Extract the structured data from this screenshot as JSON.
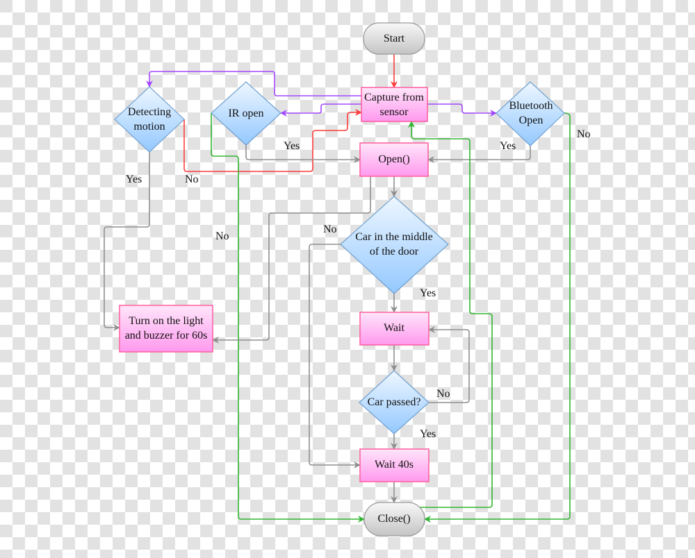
{
  "colors": {
    "process_fill": "#ff9cf0",
    "process_border": "#ff5c9d",
    "decision_fill": "#a8d2ff",
    "decision_border": "#6f9fd0",
    "terminal_fill": "#cfcfcf",
    "edge_gray": "#8f8f8f",
    "edge_red": "#ff3b3b",
    "edge_purple": "#a347ff",
    "edge_green": "#2fb52f"
  },
  "nodes": {
    "start": [
      "Start"
    ],
    "capture": [
      "Capture from",
      "sensor"
    ],
    "detecting": [
      "Detecting",
      "motion"
    ],
    "ir": [
      "IR open"
    ],
    "bluetooth": [
      "Bluetooth",
      "Open"
    ],
    "open": [
      "Open()"
    ],
    "car_middle": [
      "Car in the middle",
      "of the door"
    ],
    "turn_on": [
      "Turn on the light",
      "and buzzer for 60s"
    ],
    "wait": [
      "Wait"
    ],
    "car_passed": [
      "Car passed?"
    ],
    "wait40": [
      "Wait 40s"
    ],
    "close": [
      "Close()"
    ]
  },
  "edge_labels": {
    "ir_yes": "Yes",
    "bt_yes": "Yes",
    "det_yes": "Yes",
    "det_no": "No",
    "open_no": "No",
    "middle_no": "No",
    "bt_no": "No",
    "middle_yes": "Yes",
    "passed_no": "No",
    "passed_yes": "Yes"
  }
}
